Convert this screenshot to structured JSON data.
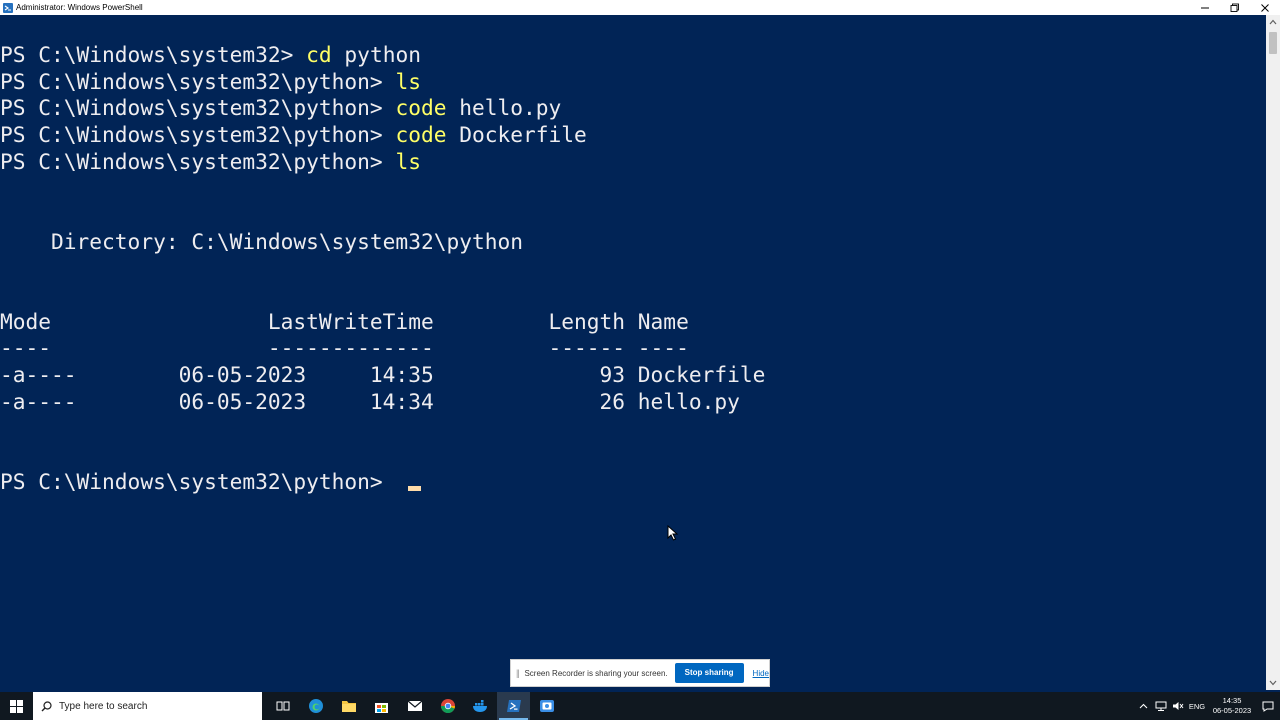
{
  "window": {
    "title": "Administrator: Windows PowerShell",
    "icons": [
      "powershell-icon",
      "minimize-icon",
      "maximize-icon",
      "close-icon"
    ]
  },
  "console": {
    "lines": [
      {
        "prompt": "PS C:\\Windows\\system32> ",
        "command": "cd",
        "args": " python"
      },
      {
        "prompt": "PS C:\\Windows\\system32\\python> ",
        "command": "ls",
        "args": ""
      },
      {
        "prompt": "PS C:\\Windows\\system32\\python> ",
        "command": "code",
        "args": " hello.py"
      },
      {
        "prompt": "PS C:\\Windows\\system32\\python> ",
        "command": "code",
        "args": " Dockerfile"
      },
      {
        "prompt": "PS C:\\Windows\\system32\\python> ",
        "command": "ls",
        "args": ""
      }
    ],
    "directory_line": "    Directory: C:\\Windows\\system32\\python",
    "table": {
      "header": "Mode                 LastWriteTime         Length Name",
      "separator": "----                 -------------         ------ ----",
      "rows": [
        "-a----        06-05-2023     14:35             93 Dockerfile",
        "-a----        06-05-2023     14:34             26 hello.py"
      ]
    },
    "final_prompt": "PS C:\\Windows\\system32\\python> "
  },
  "share_bar": {
    "message": "Screen Recorder is sharing your screen.",
    "stop_label": "Stop sharing",
    "hide_label": "Hide"
  },
  "taskbar": {
    "search_placeholder": "Type here to search",
    "apps": [
      "windows-start-icon",
      "task-view-icon",
      "edge-icon",
      "file-explorer-icon",
      "store-icon",
      "mail-icon",
      "chrome-icon",
      "docker-icon",
      "powershell-taskbar-icon",
      "screen-recorder-icon"
    ],
    "language": "ENG",
    "time": "14:35",
    "date": "06-05-2023"
  },
  "colors": {
    "console_bg": "#012456",
    "text": "#eeedf0",
    "command": "#ffff66",
    "cursor": "#fedba9",
    "taskbar_bg": "#101820",
    "accent": "#0067c0"
  }
}
